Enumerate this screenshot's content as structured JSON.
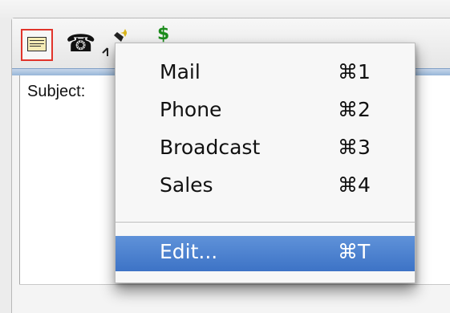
{
  "toolbar": {
    "icons": [
      {
        "name": "mail",
        "selected": true
      },
      {
        "name": "phone"
      },
      {
        "name": "broadcast"
      },
      {
        "name": "sales",
        "glyph": "$"
      }
    ]
  },
  "form": {
    "subject_label": "Subject:"
  },
  "menu": {
    "items": [
      {
        "label": "Mail",
        "shortcut": "⌘1"
      },
      {
        "label": "Phone",
        "shortcut": "⌘2"
      },
      {
        "label": "Broadcast",
        "shortcut": "⌘3"
      },
      {
        "label": "Sales",
        "shortcut": "⌘4"
      }
    ],
    "edit": {
      "label": "Edit...",
      "shortcut": "⌘T",
      "highlighted": true
    }
  },
  "colors": {
    "selection": "#3d73c6",
    "selected_icon_border": "#e1342b"
  }
}
